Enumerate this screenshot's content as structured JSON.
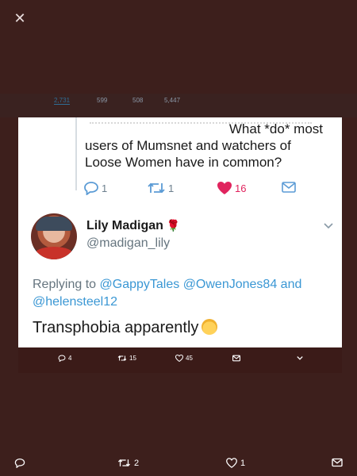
{
  "viewer": {
    "close_icon": "close-icon"
  },
  "background_profile": {
    "stats": [
      "2,731",
      "599",
      "508",
      "5,447"
    ]
  },
  "quoted_tweet": {
    "text_line1": "What *do* most",
    "text_line2": "users of Mumsnet and watchers of",
    "text_line3": "Loose Women have in common?",
    "reply_count": "1",
    "retweet_count": "1",
    "like_count": "16"
  },
  "tweet": {
    "display_name": "Lily Madigan",
    "name_emoji": "🌹",
    "handle": "@madigan_lily",
    "replying_prefix": "Replying to",
    "replying_to": [
      "@GappyTales",
      "@OwenJones84"
    ],
    "and_word": "and",
    "replying_to_last": "@helensteel12",
    "body": "Transphobia apparently"
  },
  "under_card_actions": {
    "reply": "4",
    "retweet": "15",
    "like": "45"
  },
  "bottom_bar": {
    "reply": "",
    "retweet": "2",
    "like": "1"
  },
  "colors": {
    "background": "#3d1f1c",
    "like_active": "#e0245e",
    "link": "#3a97d4",
    "muted": "#66757f"
  }
}
